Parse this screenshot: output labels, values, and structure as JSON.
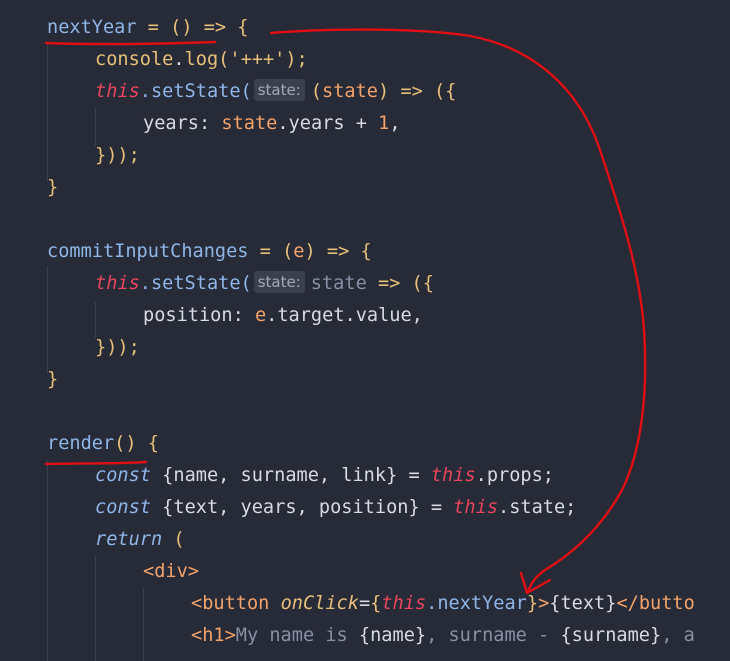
{
  "colors": {
    "background": "#272a37",
    "annotation": "#e10f14"
  },
  "annotation_arrow": "hand-drawn red arrow from nextYear declaration to onClick handler",
  "code_lines": [
    {
      "tokens": [
        {
          "t": "nextYear",
          "c": "#8fb6e8"
        },
        {
          "t": " = () => {",
          "c": "#e6c07b"
        }
      ]
    },
    {
      "tokens": [
        {
          "t": "console",
          "c": "#e6c07b"
        },
        {
          "t": ".",
          "c": "#d7dbe6"
        },
        {
          "t": "log",
          "c": "#e6c07b"
        },
        {
          "t": "(",
          "c": "#e6c07b"
        },
        {
          "t": "'+++'",
          "c": "#e6c07b"
        },
        {
          "t": ");",
          "c": "#e6c07b"
        }
      ]
    },
    {
      "tokens": [
        {
          "t": "this",
          "c": "#e6455b",
          "i": true
        },
        {
          "t": ".setState(",
          "c": "#8fb6e8"
        },
        {
          "hint": "state:"
        },
        {
          "t": "(",
          "c": "#e6c07b"
        },
        {
          "t": "state",
          "c": "#f2a36b"
        },
        {
          "t": ") => ({",
          "c": "#e6c07b"
        }
      ]
    },
    {
      "tokens": [
        {
          "t": "years",
          "c": "#d7dbe6"
        },
        {
          "t": ": ",
          "c": "#d7dbe6"
        },
        {
          "t": "state",
          "c": "#f2a36b"
        },
        {
          "t": ".years + ",
          "c": "#d7dbe6"
        },
        {
          "t": "1",
          "c": "#f2a36b"
        },
        {
          "t": ",",
          "c": "#d7dbe6"
        }
      ]
    },
    {
      "tokens": [
        {
          "t": "}));",
          "c": "#e6c07b"
        }
      ]
    },
    {
      "tokens": [
        {
          "t": "}",
          "c": "#e6c07b"
        }
      ]
    },
    {
      "tokens": []
    },
    {
      "tokens": [
        {
          "t": "commitInputChanges",
          "c": "#8fb6e8"
        },
        {
          "t": " = (",
          "c": "#e6c07b"
        },
        {
          "t": "e",
          "c": "#f2a36b"
        },
        {
          "t": ") => {",
          "c": "#e6c07b"
        }
      ]
    },
    {
      "tokens": [
        {
          "t": "this",
          "c": "#e6455b",
          "i": true
        },
        {
          "t": ".setState(",
          "c": "#8fb6e8"
        },
        {
          "hint": "state:"
        },
        {
          "t": "state",
          "c": "#8a8fa6"
        },
        {
          "t": " => ({",
          "c": "#e6c07b"
        }
      ]
    },
    {
      "tokens": [
        {
          "t": "position",
          "c": "#d7dbe6"
        },
        {
          "t": ": ",
          "c": "#d7dbe6"
        },
        {
          "t": "e",
          "c": "#f2a36b"
        },
        {
          "t": ".target.value,",
          "c": "#d7dbe6"
        }
      ]
    },
    {
      "tokens": [
        {
          "t": "}));",
          "c": "#e6c07b"
        }
      ]
    },
    {
      "tokens": [
        {
          "t": "}",
          "c": "#e6c07b"
        }
      ]
    },
    {
      "tokens": []
    },
    {
      "tokens": [
        {
          "t": "render",
          "c": "#8fb6e8"
        },
        {
          "t": "() {",
          "c": "#e6c07b"
        }
      ]
    },
    {
      "tokens": [
        {
          "t": "const",
          "c": "#8fb6e8",
          "i": true
        },
        {
          "t": " {name, surname, link} = ",
          "c": "#d7dbe6"
        },
        {
          "t": "this",
          "c": "#e6455b",
          "i": true
        },
        {
          "t": ".props;",
          "c": "#d7dbe6"
        }
      ]
    },
    {
      "tokens": [
        {
          "t": "const",
          "c": "#8fb6e8",
          "i": true
        },
        {
          "t": " {text, years, position} = ",
          "c": "#d7dbe6"
        },
        {
          "t": "this",
          "c": "#e6455b",
          "i": true
        },
        {
          "t": ".state;",
          "c": "#d7dbe6"
        }
      ]
    },
    {
      "tokens": [
        {
          "t": "return",
          "c": "#8fb6e8",
          "i": true
        },
        {
          "t": " (",
          "c": "#e6c07b"
        }
      ]
    },
    {
      "tokens": [
        {
          "t": "<div>",
          "c": "#f2a36b"
        }
      ]
    },
    {
      "tokens": [
        {
          "t": "<button ",
          "c": "#f2a36b"
        },
        {
          "t": "onClick",
          "c": "#e6c07b",
          "i": true
        },
        {
          "t": "=",
          "c": "#d7dbe6"
        },
        {
          "t": "{",
          "c": "#e6c07b"
        },
        {
          "t": "this",
          "c": "#e6455b",
          "i": true
        },
        {
          "t": ".nextYear",
          "c": "#8fb6e8"
        },
        {
          "t": "}",
          "c": "#e6c07b"
        },
        {
          "t": ">",
          "c": "#f2a36b"
        },
        {
          "t": "{text}",
          "c": "#d7dbe6"
        },
        {
          "t": "</butto",
          "c": "#f2a36b"
        }
      ]
    },
    {
      "tokens": [
        {
          "t": "<h1>",
          "c": "#f2a36b"
        },
        {
          "t": "My name is ",
          "c": "#8a8fa6"
        },
        {
          "t": "{name}",
          "c": "#d7dbe6"
        },
        {
          "t": ", surname - ",
          "c": "#8a8fa6"
        },
        {
          "t": "{surname}",
          "c": "#d7dbe6"
        },
        {
          "t": ", a",
          "c": "#8a8fa6"
        }
      ]
    }
  ]
}
